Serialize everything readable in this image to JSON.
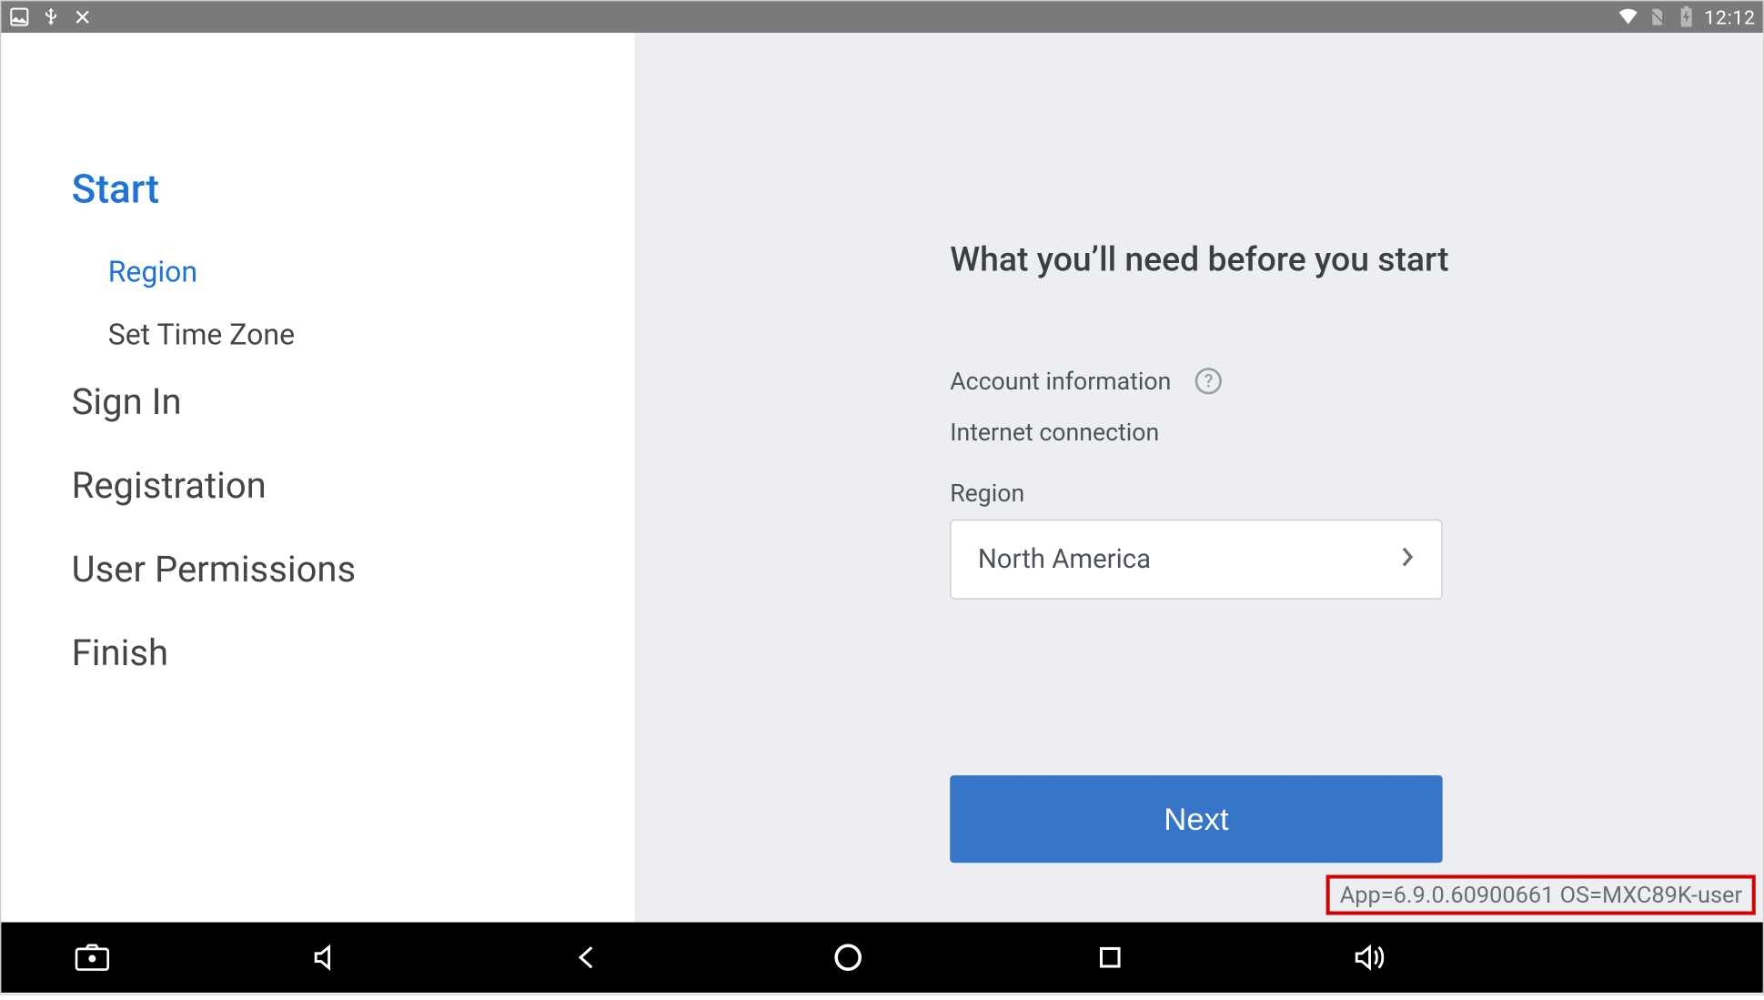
{
  "status": {
    "clock": "12:12"
  },
  "sidebar": {
    "start": "Start",
    "region": "Region",
    "set_time_zone": "Set Time Zone",
    "sign_in": "Sign In",
    "registration": "Registration",
    "user_permissions": "User Permissions",
    "finish": "Finish"
  },
  "content": {
    "heading": "What you’ll need before you start",
    "account_info": "Account information",
    "internet": "Internet connection",
    "region_label": "Region",
    "region_value": "North America",
    "next": "Next"
  },
  "version": "App=6.9.0.60900661 OS=MXC89K-user"
}
